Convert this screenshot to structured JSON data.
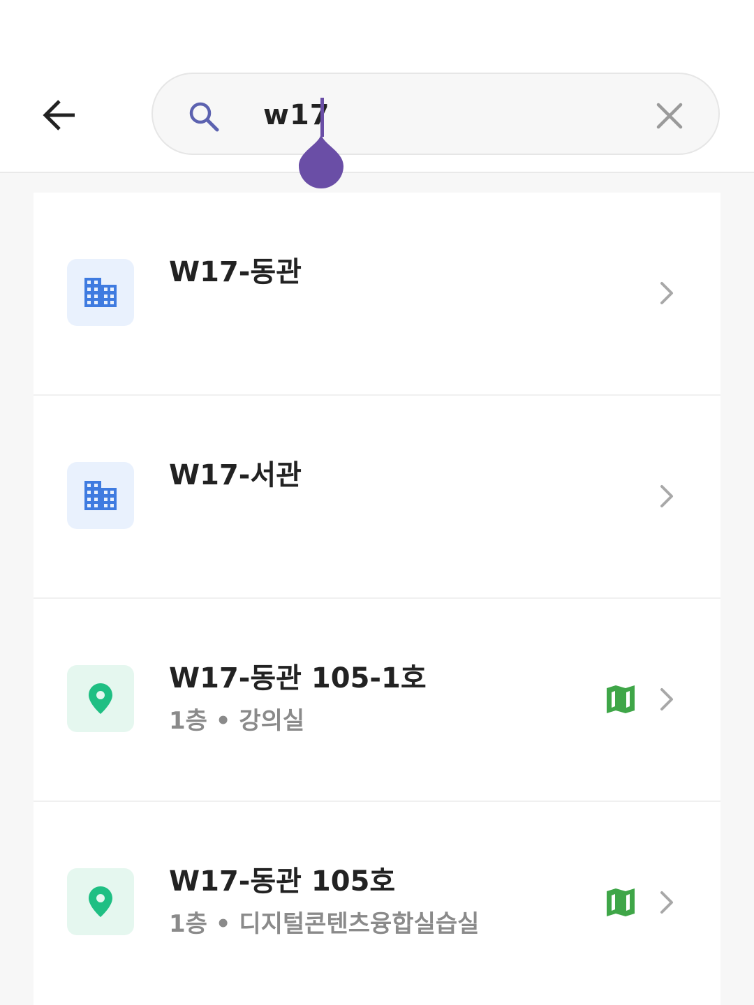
{
  "header": {
    "back_icon": "arrow-left-icon",
    "search": {
      "value": "w17",
      "icon": "search-icon",
      "clear_icon": "close-icon"
    }
  },
  "results": [
    {
      "icon": "building-icon",
      "title": "W17-동관",
      "subtitle": "",
      "has_map": false
    },
    {
      "icon": "building-icon",
      "title": "W17-서관",
      "subtitle": "",
      "has_map": false
    },
    {
      "icon": "location-pin-icon",
      "title": "W17-동관 105-1호",
      "subtitle": "1층 • 강의실",
      "has_map": true
    },
    {
      "icon": "location-pin-icon",
      "title": "W17-동관 105호",
      "subtitle": "1층 • 디지털콘텐츠융합실습실",
      "has_map": true
    }
  ],
  "colors": {
    "accent": "#6a4ea6",
    "building_icon": "#3f7be0",
    "pin_icon": "#1fbf83",
    "map_icon": "#3fa648"
  }
}
